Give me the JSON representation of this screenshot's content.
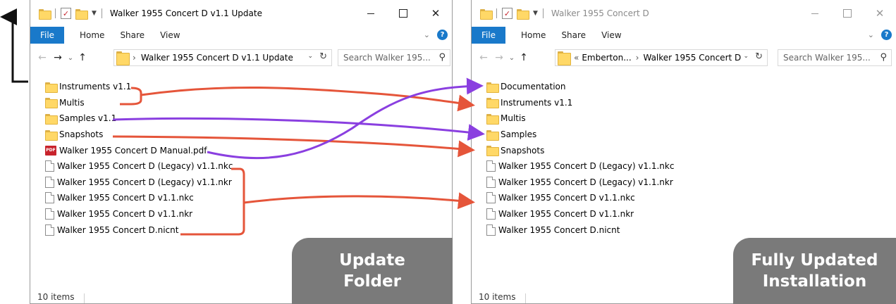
{
  "left_window": {
    "title": "Walker 1955 Concert D v1.1 Update",
    "ribbon": {
      "file": "File",
      "home": "Home",
      "share": "Share",
      "view": "View"
    },
    "address": {
      "path": "Walker 1955 Concert D v1.1 Update"
    },
    "search_placeholder": "Search Walker 195...",
    "items": [
      {
        "name": "Instruments v1.1",
        "type": "folder"
      },
      {
        "name": "Multis",
        "type": "folder"
      },
      {
        "name": "Samples v1.1",
        "type": "folder"
      },
      {
        "name": "Snapshots",
        "type": "folder"
      },
      {
        "name": "Walker 1955 Concert D Manual.pdf",
        "type": "pdf"
      },
      {
        "name": "Walker 1955 Concert D (Legacy) v1.1.nkc",
        "type": "file"
      },
      {
        "name": "Walker 1955 Concert D (Legacy) v1.1.nkr",
        "type": "file"
      },
      {
        "name": "Walker 1955 Concert D v1.1.nkc",
        "type": "file"
      },
      {
        "name": "Walker 1955 Concert D v1.1.nkr",
        "type": "file"
      },
      {
        "name": "Walker 1955 Concert D.nicnt",
        "type": "file"
      }
    ],
    "status": "10 items",
    "badge": {
      "line1": "Update",
      "line2": "Folder"
    }
  },
  "right_window": {
    "title": "Walker 1955 Concert D",
    "ribbon": {
      "file": "File",
      "home": "Home",
      "share": "Share",
      "view": "View"
    },
    "address": {
      "prefix": "«",
      "crumb1": "Emberton...",
      "path": "Walker 1955 Concert D"
    },
    "search_placeholder": "Search Walker 195...",
    "items": [
      {
        "name": "Documentation",
        "type": "folder"
      },
      {
        "name": "Instruments v1.1",
        "type": "folder"
      },
      {
        "name": "Multis",
        "type": "folder"
      },
      {
        "name": "Samples",
        "type": "folder"
      },
      {
        "name": "Snapshots",
        "type": "folder"
      },
      {
        "name": "Walker 1955 Concert D (Legacy) v1.1.nkc",
        "type": "file"
      },
      {
        "name": "Walker 1955 Concert D (Legacy) v1.1.nkr",
        "type": "file"
      },
      {
        "name": "Walker 1955 Concert D v1.1.nkc",
        "type": "file"
      },
      {
        "name": "Walker 1955 Concert D v1.1.nkr",
        "type": "file"
      },
      {
        "name": "Walker 1955 Concert D.nicnt",
        "type": "file"
      }
    ],
    "status": "10 items",
    "badge": {
      "line1": "Fully Updated",
      "line2": "Installation"
    }
  },
  "colors": {
    "accent": "#1979ca",
    "arrow_orange": "#e5553a",
    "arrow_purple": "#8a3fe0",
    "badge_bg": "#7a7a7a",
    "folder": "#ffd867"
  },
  "icons": {
    "folder": "folder-icon",
    "pdf": "pdf-icon",
    "file": "document-icon",
    "search": "search-icon",
    "refresh": "refresh-icon",
    "help": "help-icon"
  }
}
